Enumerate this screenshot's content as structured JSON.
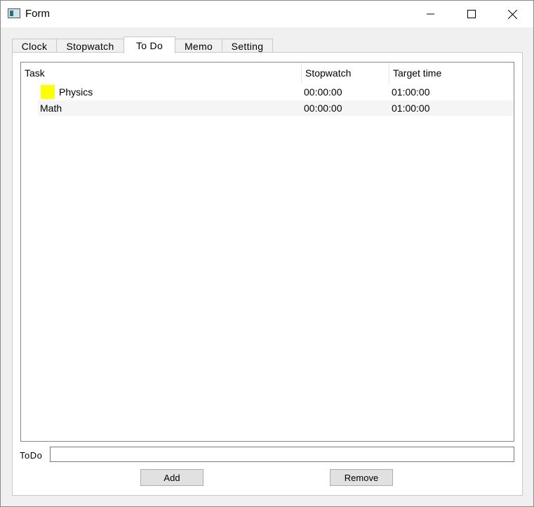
{
  "window": {
    "title": "Form",
    "minimize_glyph": "—",
    "maximize_glyph": "☐",
    "close_glyph": "✕"
  },
  "tabs": [
    {
      "label": "Clock"
    },
    {
      "label": "Stopwatch"
    },
    {
      "label": "To Do",
      "active": true
    },
    {
      "label": "Memo"
    },
    {
      "label": "Setting"
    }
  ],
  "tree": {
    "columns": [
      "Task",
      "Stopwatch",
      "Target time"
    ],
    "rows": [
      {
        "task": "Physics",
        "stopwatch": "00:00:00",
        "target": "01:00:00",
        "swatch_color": "#ffff00"
      },
      {
        "task": "Math",
        "stopwatch": "00:00:00",
        "target": "01:00:00"
      }
    ]
  },
  "form": {
    "todo_label": "ToDo",
    "todo_value": "",
    "add_label": "Add",
    "remove_label": "Remove"
  }
}
